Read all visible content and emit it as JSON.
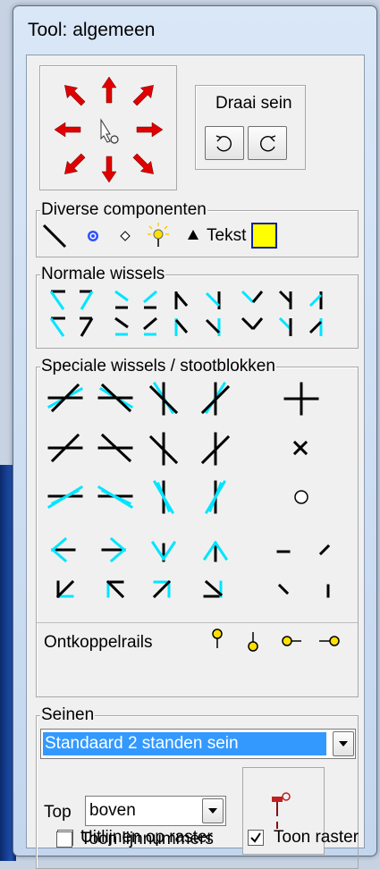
{
  "window": {
    "title": "Tool: algemeen"
  },
  "direction": {
    "label": "Draai sein",
    "rotate_left_icon": "rotate-ccw-icon",
    "rotate_right_icon": "rotate-cw-icon"
  },
  "groups": {
    "diverse": {
      "label": "Diverse componenten",
      "text_label": "Tekst",
      "text_color": "#ffff00"
    },
    "normal_switches": {
      "label": "Normale wissels"
    },
    "special_switches": {
      "label": "Speciale wissels / stootblokken"
    },
    "uncouple": {
      "label": "Ontkoppelrails"
    },
    "signals": {
      "label": "Seinen"
    }
  },
  "signals": {
    "type_selected": "Standaard 2 standen sein",
    "top_label": "Top",
    "top_selected": "boven"
  },
  "options": {
    "align_grid": {
      "label": "Uitlijnen op raster",
      "checked": true
    },
    "show_grid": {
      "label": "Toon raster",
      "checked": true
    },
    "show_line_numbers": {
      "label": "Toon lijnnummers",
      "checked": false
    }
  },
  "colors": {
    "arrow": "#e00000",
    "cyan": "#00e5ff",
    "select_bg": "#3399ff",
    "uncouple": "#ffe000"
  }
}
